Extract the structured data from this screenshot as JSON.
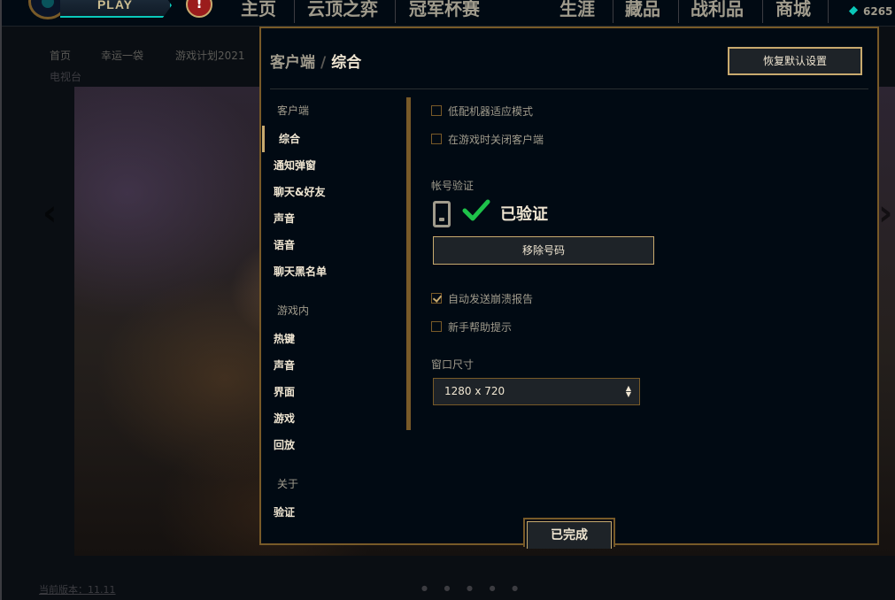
{
  "background": {
    "play_label": "PLAY",
    "alert_glyph": "!",
    "topnav": [
      "主页",
      "云顶之弈",
      "冠军杯赛",
      "生涯",
      "藏品",
      "战利品",
      "商城"
    ],
    "currency_amount": "6265",
    "subnav": [
      "首页",
      "幸运一袋",
      "游戏计划2021"
    ],
    "subnav_sub": "电视台",
    "footer_link": "当前版本：11.11",
    "carousel_dots": "● ● ● ● ●"
  },
  "settings": {
    "breadcrumb_section": "客户端",
    "breadcrumb_sep": "/",
    "breadcrumb_current": "综合",
    "restore_defaults_label": "恢复默认设置",
    "sidebar": {
      "client_section": "客户端",
      "client_items": [
        "综合",
        "通知弹窗",
        "聊天&好友",
        "声音",
        "语音",
        "聊天黑名单"
      ],
      "ingame_section": "游戏内",
      "ingame_items": [
        "热键",
        "声音",
        "界面",
        "游戏",
        "回放"
      ],
      "about_section": "关于",
      "about_items": [
        "验证"
      ]
    },
    "content": {
      "low_spec_label": "低配机器适应模式",
      "low_spec_checked": false,
      "close_client_label": "在游戏时关闭客户端",
      "close_client_checked": false,
      "account_verification_label": "帐号验证",
      "verified_status": "已验证",
      "remove_number_label": "移除号码",
      "crash_report_label": "自动发送崩溃报告",
      "crash_report_checked": true,
      "newbie_tips_label": "新手帮助提示",
      "newbie_tips_checked": false,
      "window_size_label": "窗口尺寸",
      "window_size_value": "1280 x 720"
    },
    "done_label": "已完成"
  },
  "colors": {
    "gold": "#c8aa6e",
    "gold_dark": "#785a28",
    "verified_green": "#1ec24a",
    "text_light": "#f0e6d2",
    "text_muted": "#a09b8c"
  }
}
